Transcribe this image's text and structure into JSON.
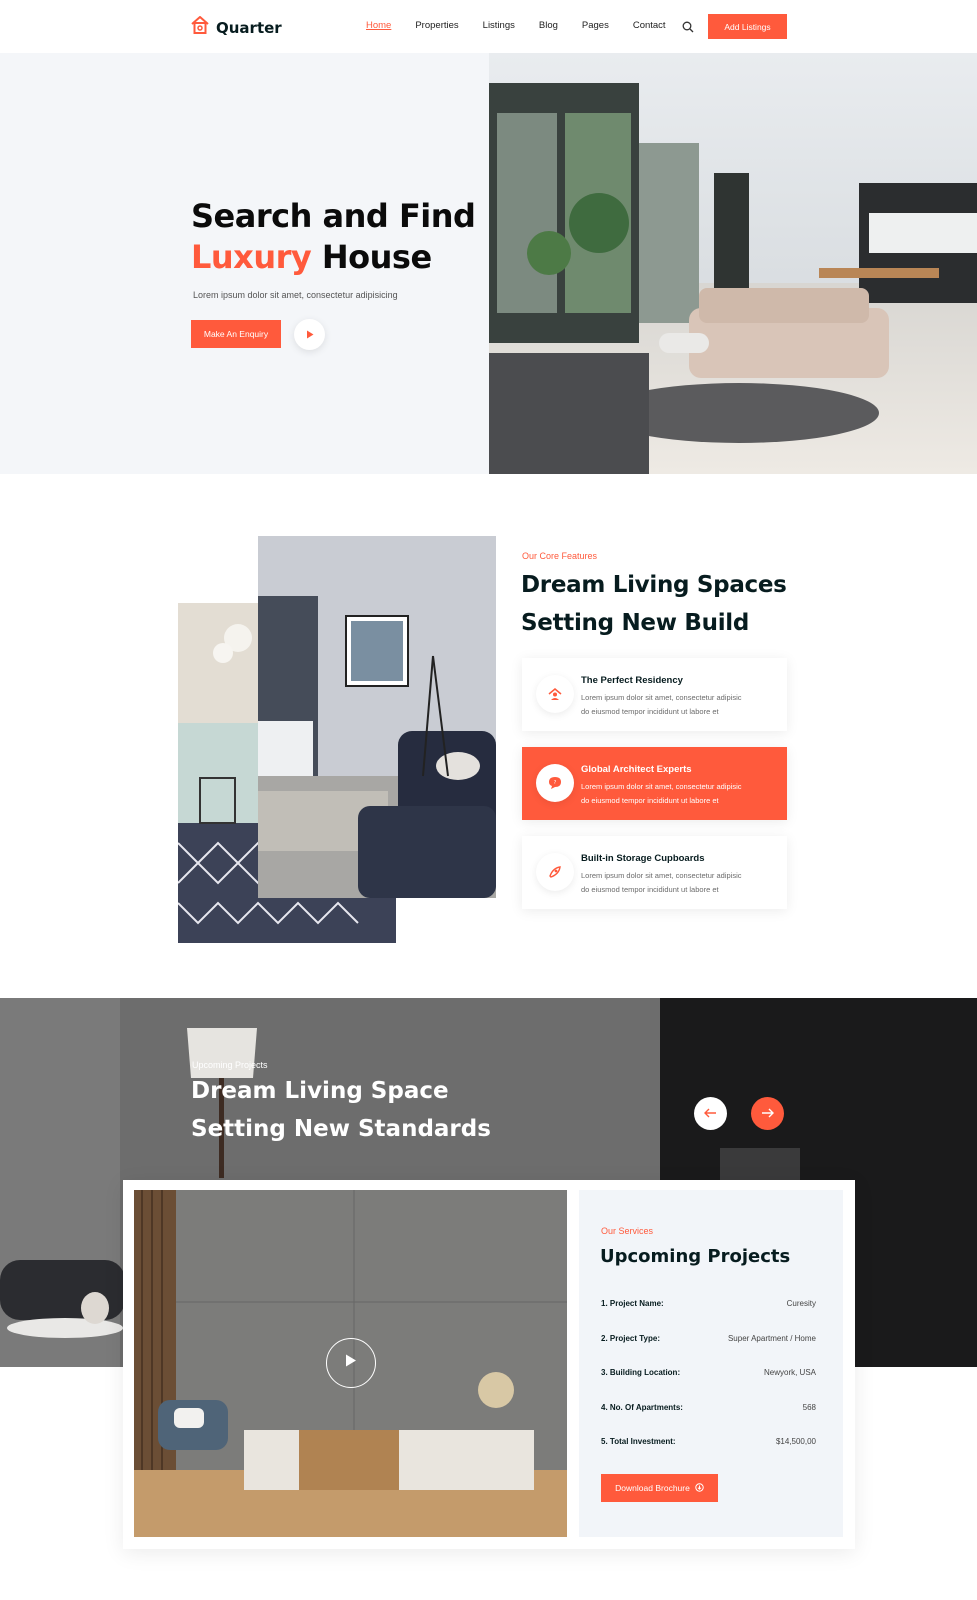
{
  "header": {
    "logo_text": "Quarter",
    "nav": [
      "Home",
      "Properties",
      "Listings",
      "Blog",
      "Pages",
      "Contact"
    ],
    "active_nav": "Home",
    "cta_label": "Add Listings"
  },
  "hero": {
    "title_line1": "Search and Find",
    "title_accent": "Luxury",
    "title_rest": "House",
    "subtitle": "Lorem ipsum dolor sit amet, consectetur adipisicing",
    "enquiry_label": "Make An Enquiry"
  },
  "features": {
    "kicker": "Our Core Features",
    "title_line1": "Dream Living Spaces",
    "title_line2": "Setting New Build",
    "cards": [
      {
        "title": "The Perfect Residency",
        "line1": "Lorem ipsum dolor sit amet, consectetur adipisic",
        "line2": "do eiusmod tempor incididunt ut labore et",
        "icon": "house-person-icon"
      },
      {
        "title": "Global Architect Experts",
        "line1": "Lorem ipsum dolor sit amet, consectetur adipisic",
        "line2": "do eiusmod tempor incididunt ut labore et",
        "icon": "chat-bubble-icon"
      },
      {
        "title": "Built-in Storage Cupboards",
        "line1": "Lorem ipsum dolor sit amet, consectetur adipisic",
        "line2": "do eiusmod tempor incididunt ut labore et",
        "icon": "rocket-icon"
      }
    ]
  },
  "upcoming": {
    "kicker": "Upcoming Projects",
    "title_line1": "Dream Living Space",
    "title_line2": "Setting New Standards"
  },
  "projects": {
    "kicker": "Our Services",
    "title": "Upcoming Projects",
    "rows": [
      {
        "label": "1. Project Name:",
        "value": "Curesity"
      },
      {
        "label": "2. Project Type:",
        "value": "Super Apartment / Home"
      },
      {
        "label": "3. Building Location:",
        "value": "Newyork, USA"
      },
      {
        "label": "4. No. Of Apartments:",
        "value": "568"
      },
      {
        "label": "5. Total Investment:",
        "value": "$14,500,00"
      }
    ],
    "download_label": "Download Brochure"
  },
  "colors": {
    "accent": "#ff5a3c",
    "dark": "#071c1f",
    "light_bg": "#f4f6f9"
  }
}
